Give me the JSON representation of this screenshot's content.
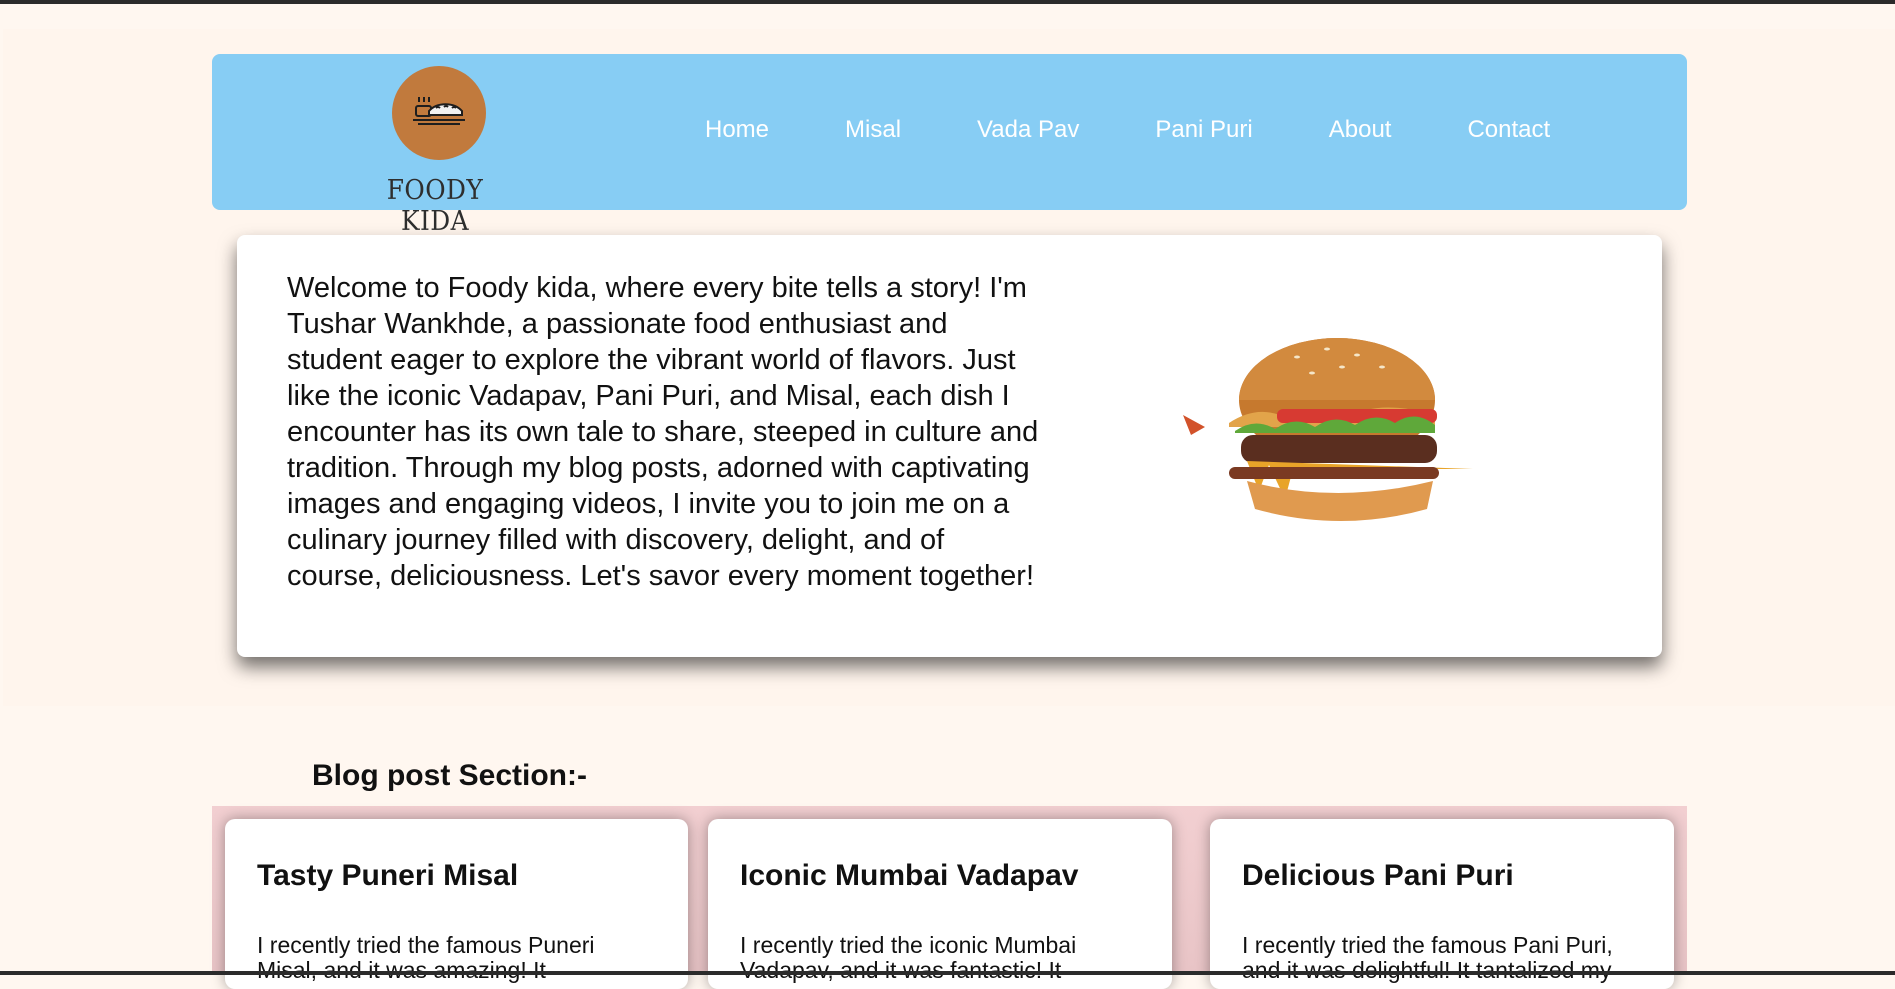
{
  "brand": {
    "name": "FOODY KIDA",
    "logo_icon": "sandwich-plate-icon"
  },
  "nav": {
    "items": [
      {
        "label": "Home"
      },
      {
        "label": "Misal"
      },
      {
        "label": "Vada Pav"
      },
      {
        "label": "Pani Puri"
      },
      {
        "label": "About"
      },
      {
        "label": "Contact"
      }
    ]
  },
  "hero": {
    "text": "Welcome to Foody kida, where every bite tells a story! I'm Tushar Wankhde, a passionate food enthusiast and student eager to explore the vibrant world of flavors. Just like the iconic Vadapav, Pani Puri, and Misal, each dish I encounter has its own tale to share, steeped in culture and tradition. Through my blog posts, adorned with captivating images and engaging videos, I invite you to join me on a culinary journey filled with discovery, delight, and of course, deliciousness. Let's savor every moment together!",
    "image": "burger-image"
  },
  "blog": {
    "title": "Blog post Section:-",
    "cards": [
      {
        "title": "Tasty Puneri Misal",
        "text": "I recently tried the famous Puneri Misal, and it was amazing! It"
      },
      {
        "title": "Iconic Mumbai Vadapav",
        "text": "I recently tried the iconic Mumbai Vadapav, and it was fantastic! It"
      },
      {
        "title": "Delicious Pani Puri",
        "text": "I recently tried the famous Pani Puri, and it was delightful! It tantalized my"
      }
    ]
  },
  "colors": {
    "header": "#87cdf4",
    "logo": "#c17a3d",
    "page": "#fff7f0",
    "strip": "#f2cfd1"
  }
}
